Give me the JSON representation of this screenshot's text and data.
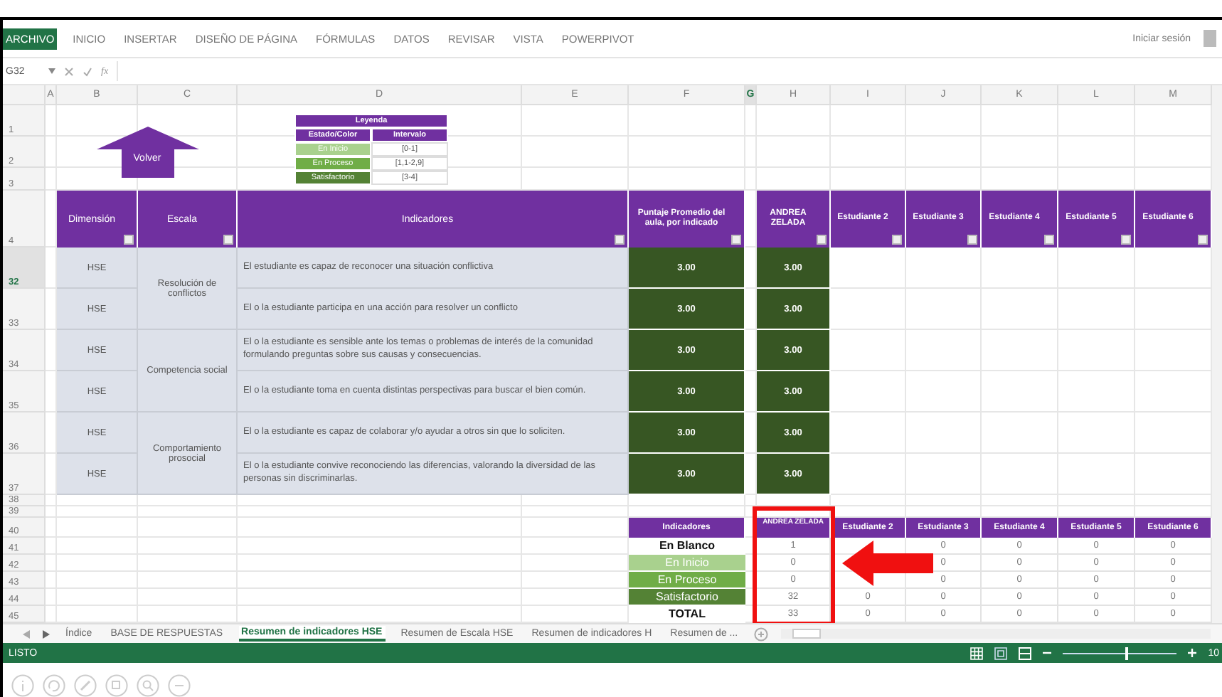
{
  "ribbon": {
    "tabs": [
      {
        "label": "ARCHIVO",
        "selected": true
      },
      {
        "label": "INICIO",
        "selected": false
      },
      {
        "label": "INSERTAR",
        "selected": false
      },
      {
        "label": "DISEÑO DE PÁGINA",
        "selected": false
      },
      {
        "label": "FÓRMULAS",
        "selected": false
      },
      {
        "label": "DATOS",
        "selected": false
      },
      {
        "label": "REVISAR",
        "selected": false
      },
      {
        "label": "VISTA",
        "selected": false
      },
      {
        "label": "POWERPIVOT",
        "selected": false
      }
    ],
    "sign_in": "Iniciar sesión"
  },
  "formula_bar": {
    "name_box": "G32",
    "fx": "fx"
  },
  "sheet": {
    "columns": [
      {
        "label": "A",
        "selected": false
      },
      {
        "label": "B",
        "selected": false
      },
      {
        "label": "C",
        "selected": false
      },
      {
        "label": "D",
        "selected": false
      },
      {
        "label": "E",
        "selected": false
      },
      {
        "label": "F",
        "selected": false
      },
      {
        "label": "G",
        "selected": true
      },
      {
        "label": "H",
        "selected": false
      },
      {
        "label": "I",
        "selected": false
      },
      {
        "label": "J",
        "selected": false
      },
      {
        "label": "K",
        "selected": false
      },
      {
        "label": "L",
        "selected": false
      },
      {
        "label": "M",
        "selected": false
      }
    ],
    "rows": [
      {
        "label": "1",
        "selected": false
      },
      {
        "label": "2",
        "selected": false
      },
      {
        "label": "3",
        "selected": false
      },
      {
        "label": "4",
        "selected": false
      },
      {
        "label": "32",
        "selected": true
      },
      {
        "label": "33",
        "selected": false
      },
      {
        "label": "34",
        "selected": false
      },
      {
        "label": "35",
        "selected": false
      },
      {
        "label": "36",
        "selected": false
      },
      {
        "label": "37",
        "selected": false
      },
      {
        "label": "38",
        "selected": false
      },
      {
        "label": "39",
        "selected": false
      },
      {
        "label": "40",
        "selected": false
      },
      {
        "label": "41",
        "selected": false
      },
      {
        "label": "42",
        "selected": false
      },
      {
        "label": "43",
        "selected": false
      },
      {
        "label": "44",
        "selected": false
      },
      {
        "label": "45",
        "selected": false
      }
    ]
  },
  "back_button": "Volver",
  "legend": {
    "title": "Leyenda",
    "headers": [
      "Estado/Color",
      "Intervalo"
    ],
    "rows": [
      {
        "label": "En Inicio",
        "kind": "inicio",
        "interval": "[0-1]"
      },
      {
        "label": "En Proceso",
        "kind": "proceso",
        "interval": "[1,1-2,9]"
      },
      {
        "label": "Satisfactorio",
        "kind": "satisfactorio",
        "interval": "[3-4]"
      }
    ]
  },
  "table": {
    "headers": {
      "dimension": "Dimensión",
      "scale": "Escala",
      "indicators": "Indicadores",
      "average": "Puntaje Promedio del aula, por indicado",
      "students": [
        "ANDREA ZELADA",
        "Estudiante 2",
        "Estudiante 3",
        "Estudiante 4",
        "Estudiante 5",
        "Estudiante 6"
      ]
    },
    "groups": [
      {
        "scale": "Resolución de conflictos",
        "items": [
          {
            "dimension": "HSE",
            "indicator": "El estudiante es capaz de reconocer una situación conflictiva",
            "average": "3.00",
            "scores": [
              "3.00"
            ]
          },
          {
            "dimension": "HSE",
            "indicator": "El o la estudiante participa en una acción para resolver un conflicto",
            "average": "3.00",
            "scores": [
              "3.00"
            ]
          }
        ]
      },
      {
        "scale": "Competencia social",
        "items": [
          {
            "dimension": "HSE",
            "indicator": "El o la estudiante es sensible ante los temas o problemas de interés de la comunidad formulando preguntas sobre sus causas y consecuencias.",
            "average": "3.00",
            "scores": [
              "3.00"
            ]
          },
          {
            "dimension": "HSE",
            "indicator": "El o la estudiante toma en cuenta distintas perspectivas para buscar el bien común.",
            "average": "3.00",
            "scores": [
              "3.00"
            ]
          }
        ]
      },
      {
        "scale": "Comportamiento prosocial",
        "items": [
          {
            "dimension": "HSE",
            "indicator": "El o la estudiante es capaz de colaborar y/o ayudar a otros sin que lo soliciten.",
            "average": "3.00",
            "scores": [
              "3.00"
            ]
          },
          {
            "dimension": "HSE",
            "indicator": "El o la estudiante convive reconociendo las diferencias, valorando la diversidad de las personas sin discriminarlas.",
            "average": "3.00",
            "scores": [
              "3.00"
            ]
          }
        ]
      }
    ]
  },
  "summary": {
    "header": "Indicadores",
    "students": [
      "ANDREA ZELADA",
      "Estudiante 2",
      "Estudiante 3",
      "Estudiante 4",
      "Estudiante 5",
      "Estudiante 6"
    ],
    "rows": [
      {
        "label": "En Blanco",
        "kind": "blank",
        "andrea": "1",
        "others": [
          "0",
          "0",
          "0",
          "0"
        ]
      },
      {
        "label": "En Inicio",
        "kind": "inicio",
        "andrea": "0",
        "others": [
          "0",
          "0",
          "0",
          "0"
        ]
      },
      {
        "label": "En Proceso",
        "kind": "proceso",
        "andrea": "0",
        "others": [
          "0",
          "0",
          "0",
          "0"
        ]
      },
      {
        "label": "Satisfactorio",
        "kind": "satisfactorio",
        "andrea": "32",
        "estudiante_2": "0",
        "others": [
          "0",
          "0",
          "0",
          "0"
        ]
      },
      {
        "label": "TOTAL",
        "kind": "total",
        "andrea": "33",
        "estudiante_2": "0",
        "others": [
          "0",
          "0",
          "0",
          "0"
        ]
      }
    ]
  },
  "sheet_tabs": [
    {
      "label": "Índice",
      "selected": false
    },
    {
      "label": "BASE DE RESPUESTAS",
      "selected": false
    },
    {
      "label": "Resumen de indicadores HSE",
      "selected": true
    },
    {
      "label": "Resumen de Escala HSE",
      "selected": false
    },
    {
      "label": "Resumen de indicadores H",
      "selected": false
    },
    {
      "label": "Resumen de ...",
      "selected": false
    }
  ],
  "status_bar": {
    "status": "LISTO",
    "zoom": "10",
    "zoom_slider": {
      "level": 0.55
    }
  }
}
